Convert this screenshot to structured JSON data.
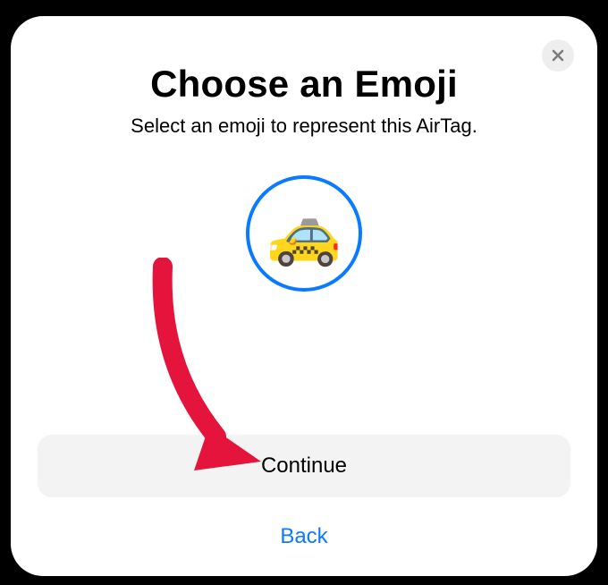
{
  "dialog": {
    "title": "Choose an Emoji",
    "subtitle": "Select an emoji to represent this AirTag.",
    "selected_emoji": "🚕",
    "continue_label": "Continue",
    "back_label": "Back"
  },
  "colors": {
    "accent": "#0a7aff",
    "button_bg": "#f3f3f4",
    "close_bg": "#eeeeef",
    "annotation": "#e5143d"
  }
}
